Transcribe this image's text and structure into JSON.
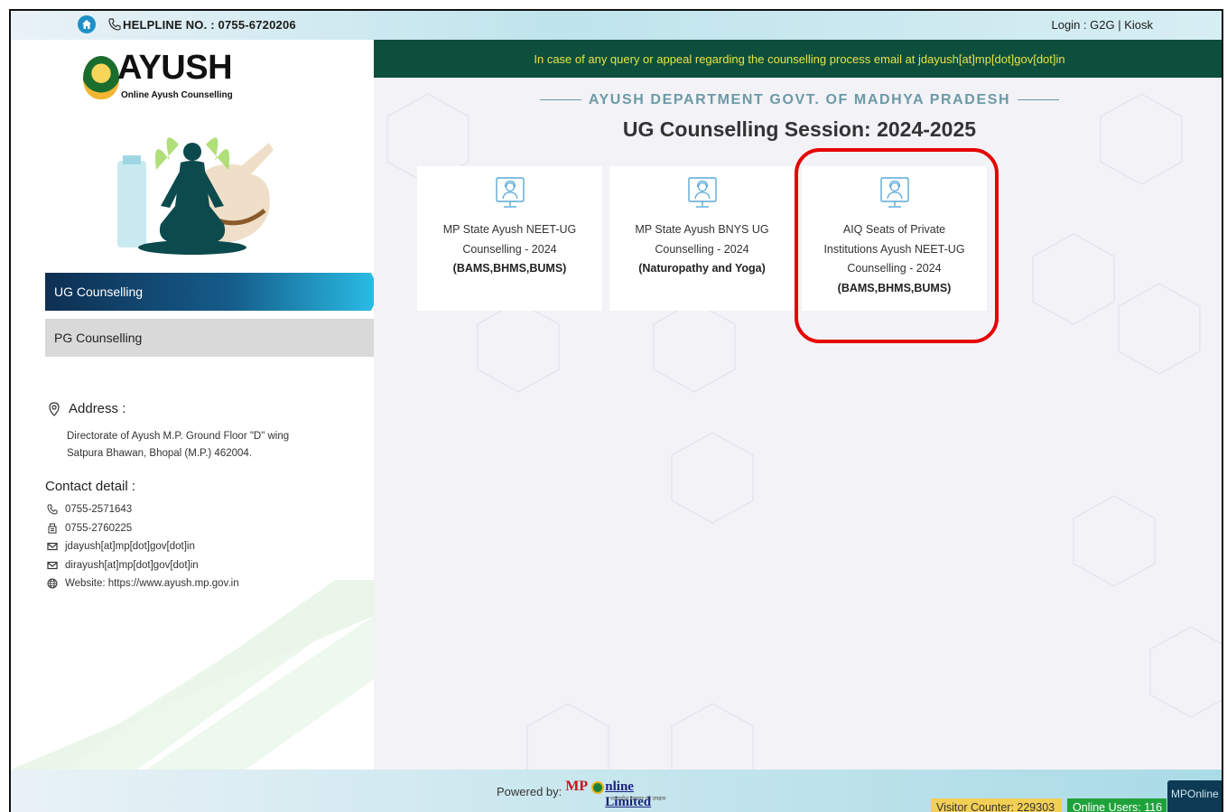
{
  "topbar": {
    "helpline": "HELPLINE NO. : 0755-6720206",
    "login": "Login : G2G | Kiosk"
  },
  "logo": {
    "title": "AYUSH",
    "subtitle": "Online Ayush Counselling"
  },
  "sidebar": {
    "items": [
      {
        "label": "UG Counselling",
        "active": true
      },
      {
        "label": "PG Counselling",
        "active": false
      }
    ],
    "address_heading": "Address :",
    "address_lines": [
      "Directorate of Ayush M.P. Ground Floor \"D\" wing",
      "Satpura Bhawan, Bhopal (M.P.) 462004."
    ],
    "contact_heading": "Contact detail :",
    "contacts": [
      {
        "icon": "phone-icon",
        "text": "0755-2571643"
      },
      {
        "icon": "fax-icon",
        "text": "0755-2760225"
      },
      {
        "icon": "mail-icon",
        "text": "jdayush[at]mp[dot]gov[dot]in"
      },
      {
        "icon": "mail-icon",
        "text": "dirayush[at]mp[dot]gov[dot]in"
      },
      {
        "icon": "globe-icon",
        "text": "Website: https://www.ayush.mp.gov.in"
      }
    ]
  },
  "main": {
    "notice": "In case of any query or appeal regarding the counselling process email at jdayush[at]mp[dot]gov[dot]in",
    "department": "AYUSH DEPARTMENT GOVT. OF MADHYA PRADESH",
    "session": "UG Counselling Session: 2024-2025",
    "cards": [
      {
        "line1": "MP State Ayush NEET-UG",
        "line2": "Counselling - 2024",
        "line3": "",
        "bold": "(BAMS,BHMS,BUMS)"
      },
      {
        "line1": "MP State Ayush BNYS UG",
        "line2": "Counselling - 2024",
        "line3": "",
        "bold": "(Naturopathy and Yoga)"
      },
      {
        "line1": "AIQ Seats of Private",
        "line2": "Institutions Ayush NEET-UG",
        "line3": "Counselling - 2024",
        "bold": "(BAMS,BHMS,BUMS)"
      }
    ]
  },
  "footer": {
    "powered_by": "Powered by:",
    "brand_mp": "MP",
    "brand_online": "nline Limited",
    "brand_tagline": "मध्यप्रदेश सरकार का उपक्रम",
    "visitor_counter": "Visitor Counter: 229303",
    "online_users": "Online Users: 116",
    "mponline_badge": "MPOnline"
  },
  "colors": {
    "notice_bg": "#0d4f3c",
    "notice_text": "#e8e24a",
    "highlight": "#e60000",
    "nav_active": "#155c8a",
    "visitor_bg": "#f2cf55",
    "online_bg": "#1ea33b"
  }
}
